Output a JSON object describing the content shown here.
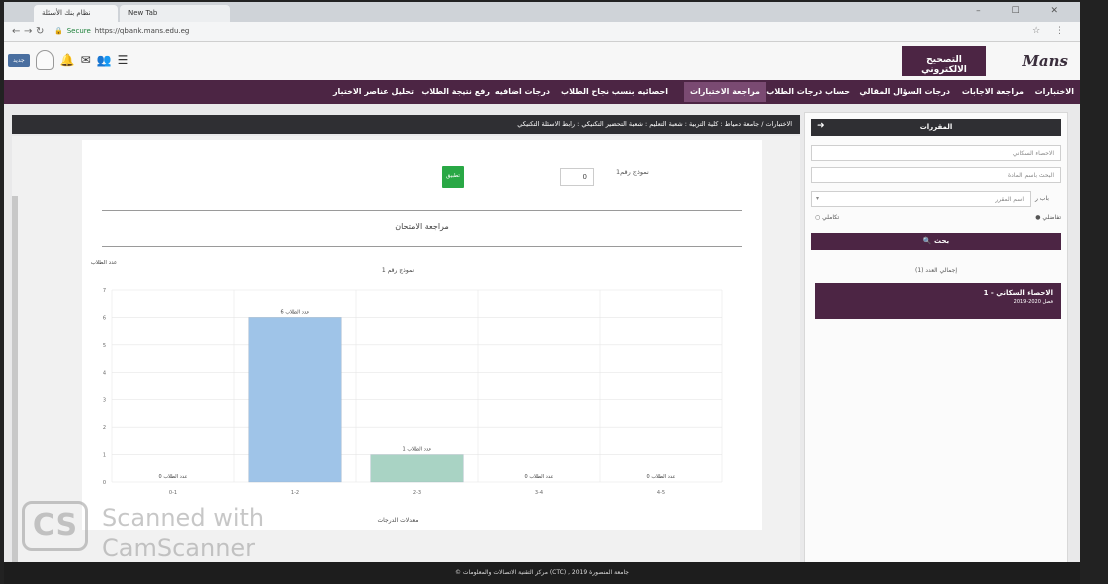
{
  "browser": {
    "tabs": [
      {
        "label": "نظام بنك الأسئلة"
      },
      {
        "label": "New Tab"
      }
    ],
    "url_secure": "Secure",
    "url": "https://qbank.mans.edu.eg",
    "window_controls": "– ☐ ✕"
  },
  "header": {
    "logo_text": "Mans",
    "app_title": "التصحيح الالكتروني",
    "new_badge": "جديد"
  },
  "main_menu": [
    {
      "label": "الاختبارات"
    },
    {
      "label": "مراجعة الاجابات"
    },
    {
      "label": "درجات السؤال المقالي"
    },
    {
      "label": "حساب درجات الطلاب"
    },
    {
      "label": "مراجعة الاختبارات",
      "active": true
    },
    {
      "label": "احصائيه بنسب نجاح الطلاب"
    },
    {
      "label": "درجات اضافيه"
    },
    {
      "label": "رفع نتيجة الطلاب"
    },
    {
      "label": "تحليل عناصر الاختبار"
    }
  ],
  "breadcrumb": "الاختبارات / جامعة دمياط : كلية التربية : شعبة التعليم : شعبة التحضير التكنيكي : رابط الاسئلة التكنيكي",
  "sidebar": {
    "title": "المقررات",
    "field_course": "الاحصاء السكاني",
    "field_search": "البحث باسم المادة",
    "select_label": "اسم المقرر",
    "select_prefix": "باب ر",
    "radio_1": "تفاضلي",
    "radio_2": "تكاملي",
    "search_button": "بحث",
    "total_label": "إجمالي العدد (1)",
    "result": {
      "title": "1 - الاحصاء السكاني",
      "subtitle": "2019-2020 فصل"
    }
  },
  "review": {
    "model_label": "نموذج رقم1",
    "model_value": "0",
    "apply_button": "تطبيق",
    "title": "مراجعة الامتحان"
  },
  "chart_data": {
    "type": "bar",
    "title": "نموذج رقم 1",
    "ylabel": "عدد الطلاب",
    "xlabel": "معدلات الدرجات",
    "categories": [
      "0-1",
      "1-2",
      "2-3",
      "3-4",
      "4-5"
    ],
    "values": [
      0,
      6,
      1,
      0,
      0
    ],
    "data_labels": [
      "عدد الطلاب 0",
      "عدد الطلاب 6",
      "عدد الطلاب 1",
      "عدد الطلاب 0",
      "عدد الطلاب 0"
    ],
    "ylim": [
      0,
      7
    ],
    "yticks": [
      0,
      1,
      2,
      3,
      4,
      5,
      6,
      7
    ],
    "colors": [
      "#9fc4e8",
      "#9fc4e8",
      "#a9d3c4",
      "#9fc4e8",
      "#9fc4e8"
    ],
    "grid": true
  },
  "footer": "© مركز التقنية الاتصالات والمعلومات (CTC) , جامعة المنصورة 2019",
  "watermark": {
    "logo": "CS",
    "line1": "Scanned with",
    "line2": "CamScanner"
  }
}
